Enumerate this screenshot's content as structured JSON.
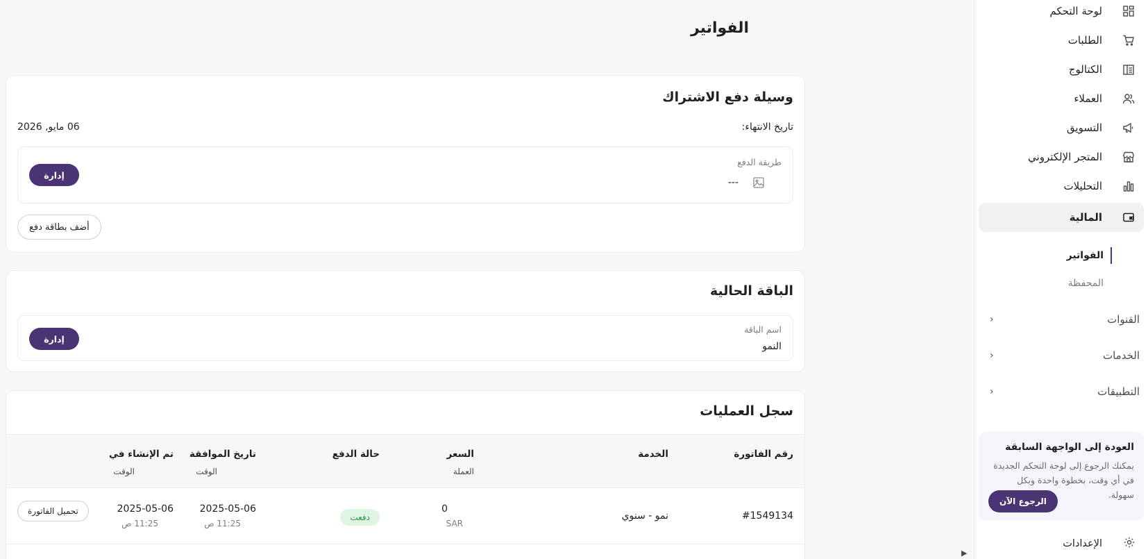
{
  "sidebar": {
    "items": [
      {
        "label": "لوحة التحكم",
        "icon": "grid-icon"
      },
      {
        "label": "الطلبات",
        "icon": "cart-icon"
      },
      {
        "label": "الكتالوج",
        "icon": "catalog-icon"
      },
      {
        "label": "العملاء",
        "icon": "users-icon"
      },
      {
        "label": "التسويق",
        "icon": "megaphone-icon"
      },
      {
        "label": "المتجر الإلكتروني",
        "icon": "store-icon"
      },
      {
        "label": "التحليلات",
        "icon": "bar-chart-icon"
      },
      {
        "label": "المالية",
        "icon": "wallet-icon"
      }
    ],
    "finance_sub": [
      "الفواتير",
      "المحفظة"
    ],
    "groups": [
      "القنوات",
      "الخدمات",
      "التطبيقات"
    ],
    "promo": {
      "title": "العودة إلى الواجهة السابقة",
      "body": "يمكنك الرجوع إلى لوحة التحكم الجديدة في أي وقت، بخطوة واحدة وبكل سهولة.",
      "button": "الرجوع الآن"
    },
    "settings": "الإعدادات"
  },
  "page": {
    "title": "الفواتير"
  },
  "payment_card": {
    "title": "وسيلة دفع الاشتراك",
    "expiry_label": "تاريخ الانتهاء:",
    "expiry_value": "06 مايو, 2026",
    "method_label": "طريقة الدفع",
    "method_value": "---",
    "manage": "إدارة",
    "add_card": "أضف بطاقة دفع"
  },
  "plan_card": {
    "title": "الباقة الحالية",
    "name_label": "اسم الباقة",
    "name_value": "النمو",
    "manage": "إدارة"
  },
  "history": {
    "title": "سجل العمليات",
    "columns": [
      {
        "label": "رقم الفاتورة",
        "sub": ""
      },
      {
        "label": "الخدمة",
        "sub": ""
      },
      {
        "label": "السعر",
        "sub": "العملة"
      },
      {
        "label": "حالة الدفع",
        "sub": ""
      },
      {
        "label": "تاريخ الموافقة",
        "sub": "الوقت"
      },
      {
        "label": "تم الإنشاء في",
        "sub": "الوقت"
      }
    ],
    "rows": [
      {
        "invoice": "#1549134",
        "service": "نمو - سنوي",
        "price": "0",
        "currency": "SAR",
        "status": "دفعت",
        "approved_date": "2025-05-06",
        "approved_time": "11:25 ص",
        "created_date": "2025-05-06",
        "created_time": "11:25 ص",
        "download": "تحميل الفاتورة"
      }
    ]
  },
  "colors": {
    "accent": "#4b3473",
    "paid_bg": "#dff5e3",
    "paid_text": "#2f8a47"
  }
}
